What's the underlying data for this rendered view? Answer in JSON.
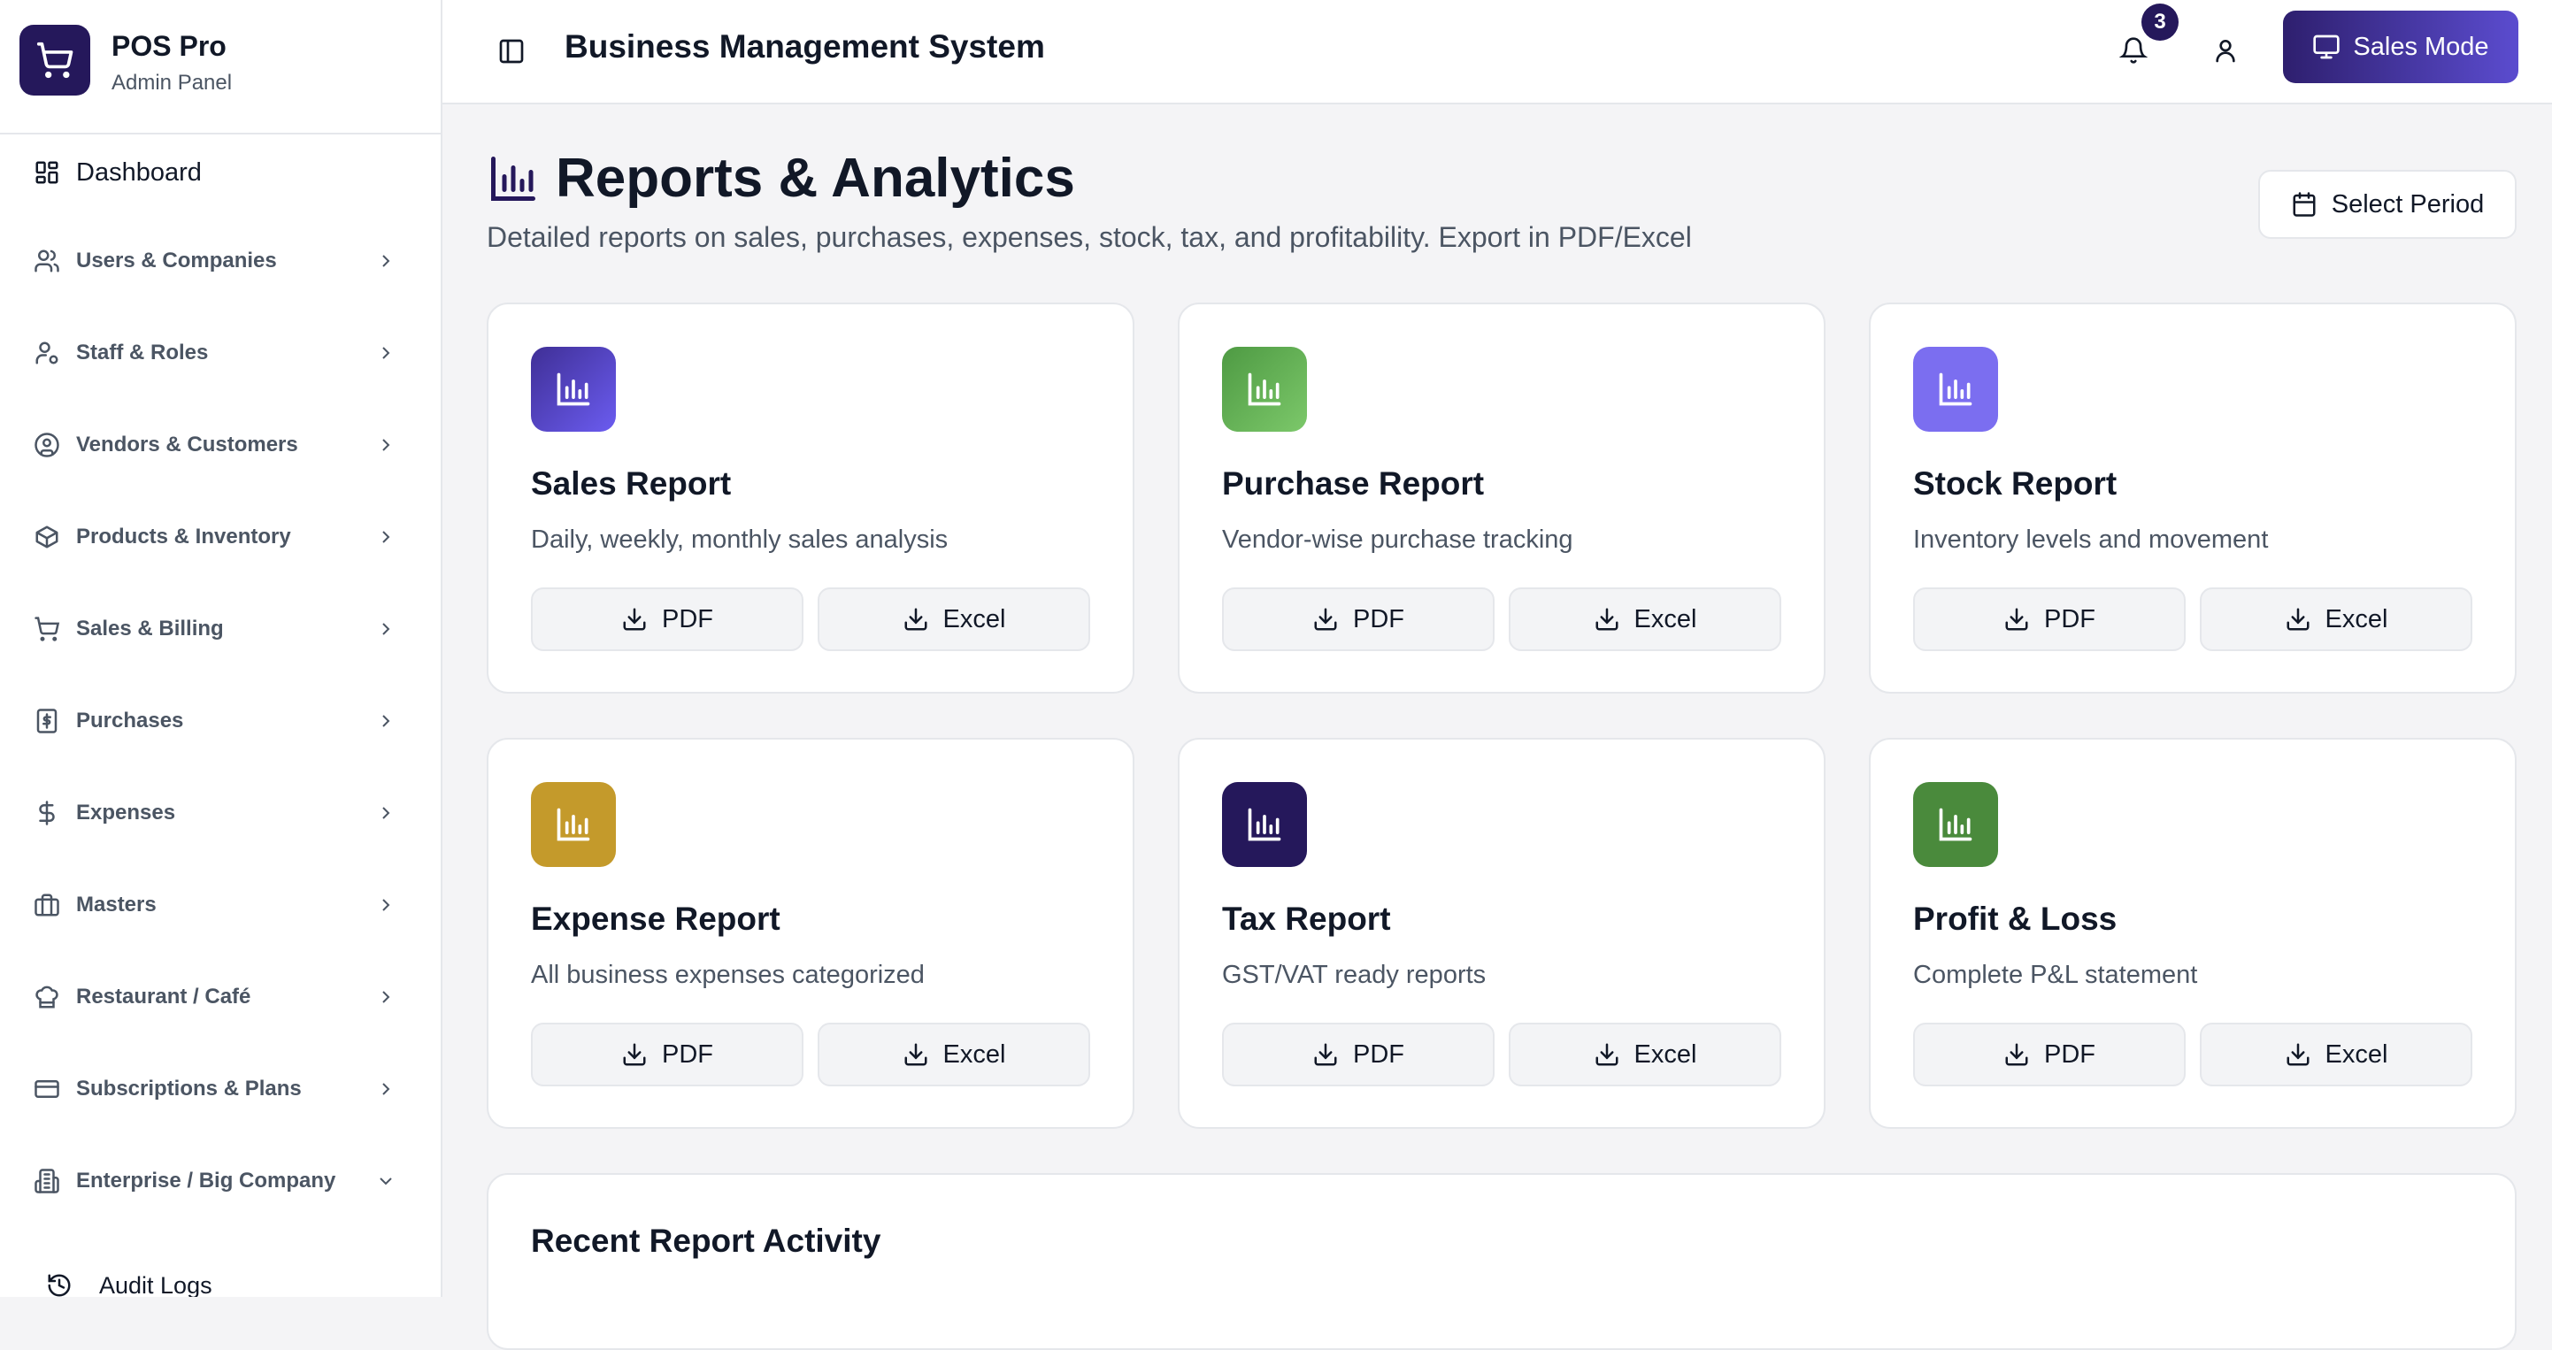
{
  "app": {
    "name": "POS Pro",
    "subtitle": "Admin Panel"
  },
  "header": {
    "title": "Business Management System",
    "notification_count": "3",
    "sales_mode_label": "Sales Mode"
  },
  "sidebar": {
    "dashboard": "Dashboard",
    "items": [
      {
        "label": "Users & Companies",
        "icon": "users-icon"
      },
      {
        "label": "Staff & Roles",
        "icon": "user-cog-icon"
      },
      {
        "label": "Vendors & Customers",
        "icon": "user-circle-icon"
      },
      {
        "label": "Products & Inventory",
        "icon": "package-icon"
      },
      {
        "label": "Sales & Billing",
        "icon": "cart-icon"
      },
      {
        "label": "Purchases",
        "icon": "receipt-icon"
      },
      {
        "label": "Expenses",
        "icon": "dollar-icon"
      },
      {
        "label": "Masters",
        "icon": "briefcase-icon"
      },
      {
        "label": "Restaurant / Café",
        "icon": "chef-hat-icon"
      },
      {
        "label": "Subscriptions & Plans",
        "icon": "credit-card-icon"
      },
      {
        "label": "Enterprise / Big Company",
        "icon": "building-icon"
      }
    ],
    "sub_items": [
      {
        "label": "Audit Logs",
        "icon": "history-icon"
      }
    ]
  },
  "page": {
    "title": "Reports & Analytics",
    "description": "Detailed reports on sales, purchases, expenses, stock, tax, and profitability. Export in PDF/Excel",
    "period_button": "Select Period"
  },
  "reports": [
    {
      "title": "Sales Report",
      "description": "Daily, weekly, monthly sales analysis",
      "color": "#3f2f96",
      "color2": "#6b5cf0",
      "pdf": "PDF",
      "excel": "Excel"
    },
    {
      "title": "Purchase Report",
      "description": "Vendor-wise purchase tracking",
      "color": "#4e9a43",
      "color2": "#7cc86a",
      "pdf": "PDF",
      "excel": "Excel"
    },
    {
      "title": "Stock Report",
      "description": "Inventory levels and movement",
      "color": "#7b6ef0",
      "color2": "#7b6ef0",
      "pdf": "PDF",
      "excel": "Excel"
    },
    {
      "title": "Expense Report",
      "description": "All business expenses categorized",
      "color": "#c49a2b",
      "color2": "#c49a2b",
      "pdf": "PDF",
      "excel": "Excel"
    },
    {
      "title": "Tax Report",
      "description": "GST/VAT ready reports",
      "color": "#25185b",
      "color2": "#25185b",
      "pdf": "PDF",
      "excel": "Excel"
    },
    {
      "title": "Profit & Loss",
      "description": "Complete P&L statement",
      "color": "#4a8a3c",
      "color2": "#4a8a3c",
      "pdf": "PDF",
      "excel": "Excel"
    }
  ],
  "activity": {
    "title": "Recent Report Activity"
  }
}
